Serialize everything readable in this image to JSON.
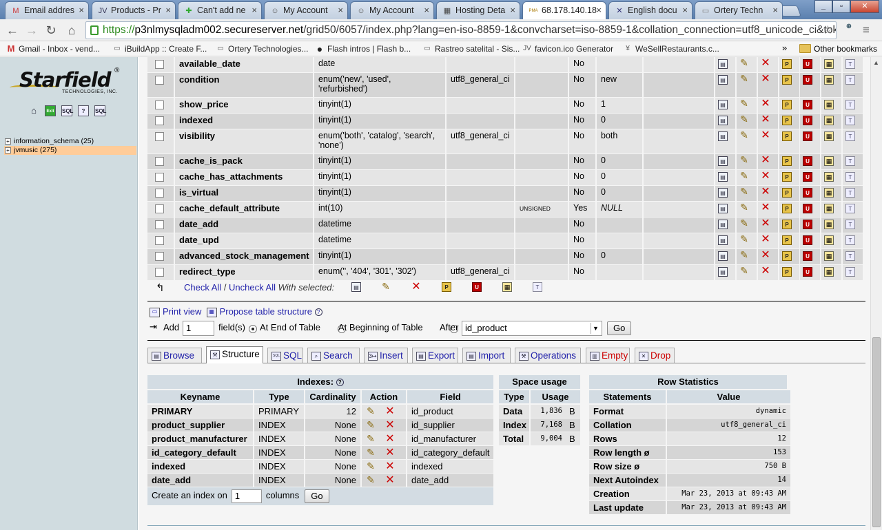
{
  "browser": {
    "tabs": [
      {
        "title": "Email addres",
        "icon": "gmail-icon",
        "glyph": "M",
        "color": "#c33"
      },
      {
        "title": "Products - Pr",
        "icon": "jv-icon",
        "glyph": "JV",
        "color": "#335"
      },
      {
        "title": "Can't add ne",
        "icon": "prestashop-icon",
        "glyph": "✚",
        "color": "#3a3"
      },
      {
        "title": "My Account",
        "icon": "account-icon",
        "glyph": "☺",
        "color": "#555"
      },
      {
        "title": "My Account",
        "icon": "account-icon",
        "glyph": "☺",
        "color": "#555"
      },
      {
        "title": "Hosting Deta",
        "icon": "hosting-icon",
        "glyph": "▦",
        "color": "#444"
      },
      {
        "title": "68.178.140.18",
        "icon": "phpmyadmin-icon",
        "glyph": "PMA",
        "color": "#a70"
      },
      {
        "title": "English docu",
        "icon": "docs-icon",
        "glyph": "✕",
        "color": "#337"
      },
      {
        "title": "Ortery Techn",
        "icon": "page-icon",
        "glyph": "▭",
        "color": "#777"
      }
    ],
    "url_scheme": "https://",
    "url_host": "p3nlmysqladm002.secureserver.net",
    "url_path": "/grid50/6057/index.php?lang=en-iso-8859-1&convcharset=iso-8859-1&collation_connection=utf8_unicode_ci&tok",
    "bookmarks": [
      {
        "label": "Gmail - Inbox - vend...",
        "icon": "gmail-icon",
        "glyph": "M"
      },
      {
        "label": "iBuildApp :: Create F...",
        "icon": "page-icon",
        "glyph": "▭"
      },
      {
        "label": "Ortery Technologies...",
        "icon": "page-icon",
        "glyph": "▭"
      },
      {
        "label": "Flash intros | Flash b...",
        "icon": "flash-icon",
        "glyph": "●"
      },
      {
        "label": "Rastreo satelital - Sis...",
        "icon": "page-icon",
        "glyph": "▭"
      },
      {
        "label": "favicon.ico Generator",
        "icon": "jv-icon",
        "glyph": "JV"
      },
      {
        "label": "WeSellRestaurants.c...",
        "icon": "restaurant-icon",
        "glyph": "¥"
      }
    ],
    "more": "»",
    "other_bookmarks": "Other bookmarks"
  },
  "sidebar": {
    "logo_word": "Starfield",
    "logo_sub": "TECHNOLOGIES, INC.",
    "logo_reg": "®",
    "quick_icons": [
      {
        "icon": "home-icon",
        "glyph": "⌂"
      },
      {
        "icon": "exit-icon",
        "glyph": "Exit"
      },
      {
        "icon": "sql-icon",
        "glyph": "SQL"
      },
      {
        "icon": "docs-icon",
        "glyph": "?"
      },
      {
        "icon": "sql-docs-icon",
        "glyph": "SQL"
      }
    ],
    "databases": [
      {
        "label": "information_schema (25)"
      },
      {
        "label": "jvmusic (275)"
      }
    ]
  },
  "fields": [
    {
      "name": "available_date",
      "type": "date",
      "collation": "",
      "attributes": "",
      "null": "No",
      "default": "",
      "extra": ""
    },
    {
      "name": "condition",
      "type": "enum('new', 'used', 'refurbished')",
      "collation": "utf8_general_ci",
      "attributes": "",
      "null": "No",
      "default": "new",
      "extra": ""
    },
    {
      "name": "show_price",
      "type": "tinyint(1)",
      "collation": "",
      "attributes": "",
      "null": "No",
      "default": "1",
      "extra": ""
    },
    {
      "name": "indexed",
      "type": "tinyint(1)",
      "collation": "",
      "attributes": "",
      "null": "No",
      "default": "0",
      "extra": ""
    },
    {
      "name": "visibility",
      "type": "enum('both', 'catalog', 'search', 'none')",
      "collation": "utf8_general_ci",
      "attributes": "",
      "null": "No",
      "default": "both",
      "extra": ""
    },
    {
      "name": "cache_is_pack",
      "type": "tinyint(1)",
      "collation": "",
      "attributes": "",
      "null": "No",
      "default": "0",
      "extra": ""
    },
    {
      "name": "cache_has_attachments",
      "type": "tinyint(1)",
      "collation": "",
      "attributes": "",
      "null": "No",
      "default": "0",
      "extra": ""
    },
    {
      "name": "is_virtual",
      "type": "tinyint(1)",
      "collation": "",
      "attributes": "",
      "null": "No",
      "default": "0",
      "extra": ""
    },
    {
      "name": "cache_default_attribute",
      "type": "int(10)",
      "collation": "",
      "attributes": "UNSIGNED",
      "null": "Yes",
      "default": "NULL",
      "extra": ""
    },
    {
      "name": "date_add",
      "type": "datetime",
      "collation": "",
      "attributes": "",
      "null": "No",
      "default": "",
      "extra": ""
    },
    {
      "name": "date_upd",
      "type": "datetime",
      "collation": "",
      "attributes": "",
      "null": "No",
      "default": "",
      "extra": ""
    },
    {
      "name": "advanced_stock_management",
      "type": "tinyint(1)",
      "collation": "",
      "attributes": "",
      "null": "No",
      "default": "0",
      "extra": ""
    },
    {
      "name": "redirect_type",
      "type": "enum('', '404', '301', '302')",
      "collation": "utf8_general_ci",
      "attributes": "",
      "null": "No",
      "default": "",
      "extra": ""
    }
  ],
  "row_actions": [
    {
      "icon": "browse-icon",
      "glyph": "▤",
      "cls": "browse"
    },
    {
      "icon": "edit-icon",
      "glyph": "✎",
      "cls": "edit"
    },
    {
      "icon": "delete-icon",
      "glyph": "✕",
      "cls": "del"
    },
    {
      "icon": "primary-key-icon",
      "glyph": "P",
      "cls": "prim"
    },
    {
      "icon": "unique-icon",
      "glyph": "U",
      "cls": "uniq"
    },
    {
      "icon": "index-icon",
      "glyph": "▦",
      "cls": "idx"
    },
    {
      "icon": "fulltext-icon",
      "glyph": "T",
      "cls": "fulltext"
    }
  ],
  "withsel": {
    "check_all": "Check All",
    "slash": " / ",
    "uncheck_all": "Uncheck All",
    "with_selected": "With selected:"
  },
  "print_view": "Print view",
  "propose": "Propose table structure",
  "add_field": {
    "add_label": "Add",
    "count": "1",
    "fields_label": "field(s)",
    "end_label": "At End of Table",
    "beginning_label": "At Beginning of Table",
    "after_label": "After",
    "after_value": "id_product",
    "go": "Go"
  },
  "tabs": [
    {
      "label": "Browse",
      "icon": "browse-icon",
      "glyph": "▤",
      "active": false,
      "red": false
    },
    {
      "label": "Structure",
      "icon": "structure-icon",
      "glyph": "⚒",
      "active": true,
      "red": false
    },
    {
      "label": "SQL",
      "icon": "sql-icon",
      "glyph": "SQL",
      "active": false,
      "red": false
    },
    {
      "label": "Search",
      "icon": "search-icon",
      "glyph": "⌕",
      "active": false,
      "red": false
    },
    {
      "label": "Insert",
      "icon": "insert-icon",
      "glyph": "3↦",
      "active": false,
      "red": false
    },
    {
      "label": "Export",
      "icon": "export-icon",
      "glyph": "▤",
      "active": false,
      "red": false
    },
    {
      "label": "Import",
      "icon": "import-icon",
      "glyph": "▤",
      "active": false,
      "red": false
    },
    {
      "label": "Operations",
      "icon": "operations-icon",
      "glyph": "⚒",
      "active": false,
      "red": false
    },
    {
      "label": "Empty",
      "icon": "empty-icon",
      "glyph": "▥",
      "active": false,
      "red": true
    },
    {
      "label": "Drop",
      "icon": "drop-icon",
      "glyph": "✕",
      "active": false,
      "red": true
    }
  ],
  "indexes": {
    "title": "Indexes:",
    "headers": [
      "Keyname",
      "Type",
      "Cardinality",
      "Action",
      "Field"
    ],
    "rows": [
      {
        "keyname": "PRIMARY",
        "type": "PRIMARY",
        "cardinality": "12",
        "field": "id_product"
      },
      {
        "keyname": "product_supplier",
        "type": "INDEX",
        "cardinality": "None",
        "field": "id_supplier"
      },
      {
        "keyname": "product_manufacturer",
        "type": "INDEX",
        "cardinality": "None",
        "field": "id_manufacturer"
      },
      {
        "keyname": "id_category_default",
        "type": "INDEX",
        "cardinality": "None",
        "field": "id_category_default"
      },
      {
        "keyname": "indexed",
        "type": "INDEX",
        "cardinality": "None",
        "field": "indexed"
      },
      {
        "keyname": "date_add",
        "type": "INDEX",
        "cardinality": "None",
        "field": "date_add"
      }
    ],
    "create_label": "Create an index on",
    "create_count": "1",
    "columns_label": "columns",
    "go": "Go"
  },
  "space_usage": {
    "title": "Space usage",
    "headers": [
      "Type",
      "Usage"
    ],
    "rows": [
      {
        "type": "Data",
        "value": "1,836",
        "unit": "B"
      },
      {
        "type": "Index",
        "value": "7,168",
        "unit": "B"
      },
      {
        "type": "Total",
        "value": "9,004",
        "unit": "B"
      }
    ]
  },
  "row_stats": {
    "title": "Row Statistics",
    "headers": [
      "Statements",
      "Value"
    ],
    "rows": [
      {
        "statement": "Format",
        "value": "dynamic"
      },
      {
        "statement": "Collation",
        "value": "utf8_general_ci"
      },
      {
        "statement": "Rows",
        "value": "12"
      },
      {
        "statement": "Row length ø",
        "value": "153"
      },
      {
        "statement": "Row size ø",
        "value": "750 B"
      },
      {
        "statement": "Next Autoindex",
        "value": "14"
      },
      {
        "statement": "Creation",
        "value": "Mar 23, 2013 at 09:43 AM"
      },
      {
        "statement": "Last update",
        "value": "Mar 23, 2013 at 09:43 AM"
      }
    ]
  }
}
